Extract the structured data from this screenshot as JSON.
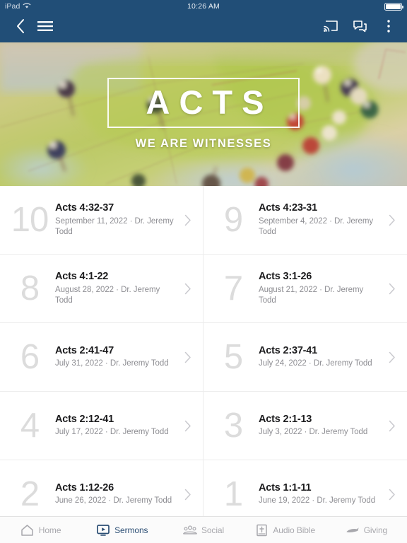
{
  "status_bar": {
    "device": "iPad",
    "wifi_icon": "wifi-icon",
    "time": "10:26 AM",
    "battery_icon": "battery-full-icon"
  },
  "nav_bar": {
    "background_color": "#214e77",
    "back_icon": "chevron-left-icon",
    "menu_icon": "hamburger-menu-icon",
    "cast_icon": "cast-icon",
    "chat_icon": "chat-bubbles-icon",
    "overflow_icon": "more-vertical-icon"
  },
  "hero": {
    "title": "ACTS",
    "subtitle": "WE ARE WITNESSES",
    "image_description": "blurred world map with colored push pins"
  },
  "sermons": [
    {
      "number": "10",
      "title": "Acts 4:32-37",
      "meta": "September 11, 2022 · Dr. Jeremy Todd",
      "chevron": "chevron-right-icon"
    },
    {
      "number": "9",
      "title": "Acts 4:23-31",
      "meta": "September 4, 2022 · Dr. Jeremy Todd",
      "chevron": "chevron-right-icon"
    },
    {
      "number": "8",
      "title": "Acts 4:1-22",
      "meta": "August 28, 2022 · Dr. Jeremy Todd",
      "chevron": "chevron-right-icon"
    },
    {
      "number": "7",
      "title": "Acts 3:1-26",
      "meta": "August 21, 2022 · Dr. Jeremy Todd",
      "chevron": "chevron-right-icon"
    },
    {
      "number": "6",
      "title": "Acts 2:41-47",
      "meta": "July 31, 2022 · Dr. Jeremy Todd",
      "chevron": "chevron-right-icon"
    },
    {
      "number": "5",
      "title": "Acts 2:37-41",
      "meta": "July 24, 2022 · Dr. Jeremy Todd",
      "chevron": "chevron-right-icon"
    },
    {
      "number": "4",
      "title": "Acts 2:12-41",
      "meta": "July 17, 2022 · Dr. Jeremy Todd",
      "chevron": "chevron-right-icon"
    },
    {
      "number": "3",
      "title": "Acts 2:1-13",
      "meta": "July 3, 2022 · Dr. Jeremy Todd",
      "chevron": "chevron-right-icon"
    },
    {
      "number": "2",
      "title": "Acts 1:12-26",
      "meta": "June 26, 2022 · Dr. Jeremy Todd",
      "chevron": "chevron-right-icon"
    },
    {
      "number": "1",
      "title": "Acts 1:1-11",
      "meta": "June 19, 2022 · Dr. Jeremy Todd",
      "chevron": "chevron-right-icon"
    }
  ],
  "tab_bar": {
    "active_color": "#2a4d73",
    "inactive_color": "#a8a8ad",
    "tabs": [
      {
        "label": "Home",
        "icon": "home-icon",
        "active": false
      },
      {
        "label": "Sermons",
        "icon": "video-icon",
        "active": true
      },
      {
        "label": "Social",
        "icon": "people-icon",
        "active": false
      },
      {
        "label": "Audio Bible",
        "icon": "bible-book-icon",
        "active": false
      },
      {
        "label": "Giving",
        "icon": "hand-giving-icon",
        "active": false
      }
    ]
  }
}
